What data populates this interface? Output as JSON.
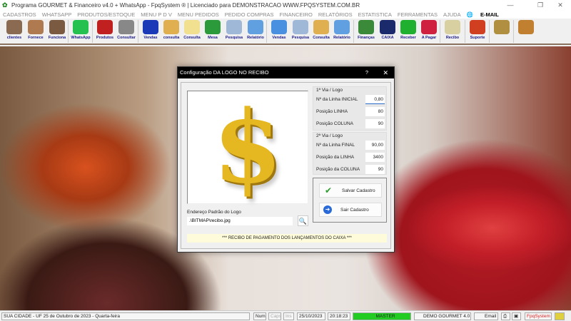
{
  "window": {
    "title": "Programa GOURMET & Financeiro v4.0 + WhatsApp - FpqSystem ® | Licenciado para  DEMONSTRACAO WWW.FPQSYSTEM.COM.BR",
    "minimize": "—",
    "maximize": "❐",
    "close": "✕"
  },
  "menu": [
    "CADASTROS",
    "WHATSAPP",
    "PRODUTOS/ESTOQUE",
    "MENU P D V",
    "MENU PEDIDOS",
    "PEDIDO COMPRAS",
    "FINANCEIRO",
    "RELATÓRIOS",
    "ESTATISTICA",
    "FERRAMENTAS",
    "AJUDA"
  ],
  "menu_email": "E-MAIL",
  "toolbar": [
    {
      "label": "clientes",
      "color": "#8a6a50"
    },
    {
      "label": "Fornece",
      "color": "#b07a50"
    },
    {
      "label": "Funciona",
      "color": "#7a5a40"
    },
    {
      "label": "WhatsApp",
      "color": "#25c150"
    },
    {
      "label": "Produtos",
      "color": "#c02020"
    },
    {
      "label": "Consultar",
      "color": "#888888"
    },
    {
      "label": "Vendas",
      "color": "#1a3ab8"
    },
    {
      "label": "consulta",
      "color": "#e0b050"
    },
    {
      "label": "Consulta",
      "color": "#f0e090"
    },
    {
      "label": "Mesa",
      "color": "#2a9a3a"
    },
    {
      "label": "Pesquisa",
      "color": "#a0b8d8"
    },
    {
      "label": "Relatório",
      "color": "#60a0e0"
    },
    {
      "label": "Vendas",
      "color": "#4a90e0"
    },
    {
      "label": "Pesquisa",
      "color": "#a0b8d8"
    },
    {
      "label": "Consulta",
      "color": "#e0b050"
    },
    {
      "label": "Relatório",
      "color": "#60a0e0"
    },
    {
      "label": "Finanças",
      "color": "#3a8a3a"
    },
    {
      "label": "CAIXA",
      "color": "#1a2a6a"
    },
    {
      "label": "Receber",
      "color": "#20b030"
    },
    {
      "label": "A Pagar",
      "color": "#d02040"
    },
    {
      "label": "Recibo",
      "color": "#d8d0a0"
    },
    {
      "label": "Suporte",
      "color": "#d04020"
    },
    {
      "label": "",
      "color": "#b09040"
    },
    {
      "label": "",
      "color": "#c08030"
    }
  ],
  "dialog": {
    "title": "Configuração DA LOGO NO RECIBO",
    "help": "?",
    "close": "✕",
    "logo_symbol": "$",
    "via1": {
      "title": "1ª Via / Logo",
      "fields": [
        {
          "label": "Nº da Linha INICIAL",
          "value": "0,80"
        },
        {
          "label": "Posição LINHA",
          "value": "80"
        },
        {
          "label": "Posição COLUNA",
          "value": "90"
        }
      ]
    },
    "via2": {
      "title": "2ª Via / Logo",
      "fields": [
        {
          "label": "Nº da Linha FINAL",
          "value": "90,00"
        },
        {
          "label": "Posição da LINHA",
          "value": "3400"
        },
        {
          "label": "Posição da COLUNA",
          "value": "90"
        }
      ]
    },
    "save_label": "Salvar Cadastro",
    "exit_label": "Sair Cadastro",
    "address_label": "Endereço Padrão do Logo",
    "address_value": ".\\BITMAP\\recibo.jpg",
    "note": "*** RECIBO DE PAGAMENTO DOS LANÇAMENTOS DO CAIXA ***"
  },
  "status": {
    "location": "SUA CIDADE - UF 25 de Outubro de 2023 - Quarta-feira",
    "num": "Num",
    "caps": "Caps",
    "ins": "Ins",
    "date": "25/10/2023",
    "time": "20:18:23",
    "user": "MASTER",
    "app": "DEMO GOURMET 4.0",
    "email": "Email",
    "brand": "FpqSystem",
    "user_color": "#22cc22",
    "brand_color": "#e02020"
  }
}
